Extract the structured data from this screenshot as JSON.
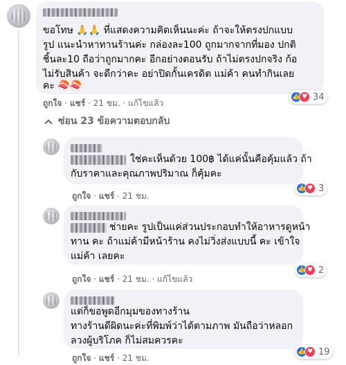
{
  "comment": {
    "lines": [
      "ขอโทษ 🙏🙏 ที่แสดงความคิดเห็นนะค่ะ ถ้าจะให้ตรงปกแบบ",
      "รูป แนะนำหาทานร้านค่ะ กล่องละ100 ถูกมากจากที่มอง ปกติ",
      "ชิ้นละ10 ถือว่าถูกมากคะ อีกอย่างตอนรับ ถ้าไม่ตรงปกจริง ก้อ",
      "ไม่รับสินค้า จะดีกว่าคะ อย่าปิดกั้นเครดิต แม่ค้า คนทำกินเลย",
      "คะ 🍣🍣"
    ],
    "actions": {
      "like": "ถูกใจ",
      "reply": "แชร์",
      "time": "21 ชม.",
      "edited": "แก้ไขแล้ว",
      "sep": "·"
    },
    "reaction_count": "34"
  },
  "replies_toggle": "ซ่อน 23 ข้อความตอบกลับ",
  "replies": [
    {
      "lines": [
        "ใช่คะเห็นด้วย 100฿ ได้แค่นั้นคือคุ้มแล้ว ถ้า",
        "กับราคาและคุณภาพปริมาณ ก็คุ้มคะ"
      ],
      "actions": {
        "like": "ถูกใจ",
        "reply": "แชร์",
        "time": "21 ชม.",
        "sep": "·"
      },
      "reaction_count": "3"
    },
    {
      "lines": [
        "ช่ายคะ รูปเป็นแค่ส่วนประกอบทำให้อาหารดูหน้า",
        "ทาน คะ ถ้าแม่ค้ามีหน้าร้าน คงไม่วิ่งส่งแบบนี้ คะ เข้าใจ",
        "แม่ค้า เลยคะ"
      ],
      "actions": {
        "like": "ถูกใจ",
        "reply": "แชร์",
        "time": "21 ชม.",
        "edited": "แก้ไขแล้ว",
        "sep": "·"
      },
      "reaction_count": "2"
    },
    {
      "lines": [
        "แต่ก็ขอพูดอีกมุมของทางร้าน",
        "ทางร้านดีผิดนะค่ะที่พิมพ์ว่าได้ตามภาพ มันถือว่าหลอก",
        "ลวงผู้บริโภค ก็ไม่สมควรคะ"
      ],
      "actions": {
        "like": "ถูกใจ",
        "reply": "แชร์",
        "time": "21 ชม.",
        "sep": "·"
      },
      "reaction_count": "19"
    }
  ],
  "colors": {
    "bubble": "#f0f2f5",
    "like": "#1877f2",
    "love": "#f33e58",
    "meta": "#65676b"
  }
}
